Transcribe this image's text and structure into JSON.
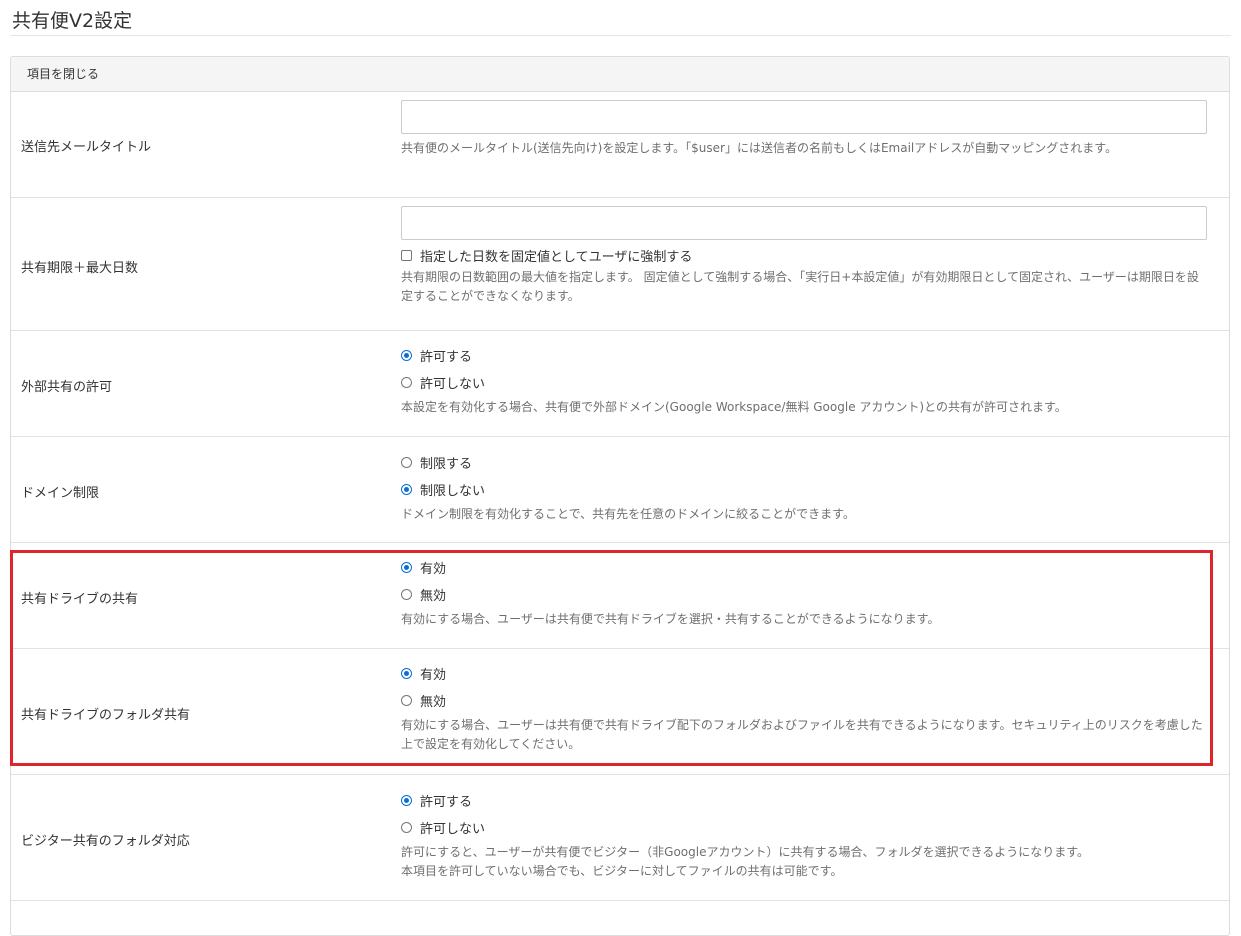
{
  "page": {
    "title": "共有便V2設定"
  },
  "panel": {
    "header": "項目を閉じる"
  },
  "colors": {
    "accent": "#0b6ed6",
    "highlight": "#e0242c"
  },
  "rows": {
    "mail_title": {
      "label": "送信先メールタイトル",
      "input_value": "",
      "help": "共有便のメールタイトル(送信先向け)を設定します。「$user」には送信者の名前もしくはEmailアドレスが自動マッピングされます。"
    },
    "max_days": {
      "label": "共有期限＋最大日数",
      "input_value": "",
      "checkbox_label": "指定した日数を固定値としてユーザに強制する",
      "help": "共有期限の日数範囲の最大値を指定します。 固定値として強制する場合、「実行日+本設定値」が有効期限日として固定され、ユーザーは期限日を設定することができなくなります。"
    },
    "external_share": {
      "label": "外部共有の許可",
      "options": [
        "許可する",
        "許可しない"
      ],
      "help": "本設定を有効化する場合、共有便で外部ドメイン(Google Workspace/無料 Google アカウント)との共有が許可されます。"
    },
    "domain_limit": {
      "label": "ドメイン制限",
      "options": [
        "制限する",
        "制限しない"
      ],
      "help": "ドメイン制限を有効化することで、共有先を任意のドメインに絞ることができます。"
    },
    "shared_drive": {
      "label": "共有ドライブの共有",
      "options": [
        "有効",
        "無効"
      ],
      "help": "有効にする場合、ユーザーは共有便で共有ドライブを選択・共有することができるようになります。"
    },
    "shared_drive_folder": {
      "label": "共有ドライブのフォルダ共有",
      "options": [
        "有効",
        "無効"
      ],
      "help": "有効にする場合、ユーザーは共有便で共有ドライブ配下のフォルダおよびファイルを共有できるようになります。セキュリティ上のリスクを考慮した上で設定を有効化してください。"
    },
    "visitor_folder": {
      "label": "ビジター共有のフォルダ対応",
      "options": [
        "許可する",
        "許可しない"
      ],
      "help1": "許可にすると、ユーザーが共有便でビジター（非Googleアカウント）に共有する場合、フォルダを選択できるようになります。",
      "help2": "本項目を許可していない場合でも、ビジターに対してファイルの共有は可能です。"
    }
  }
}
